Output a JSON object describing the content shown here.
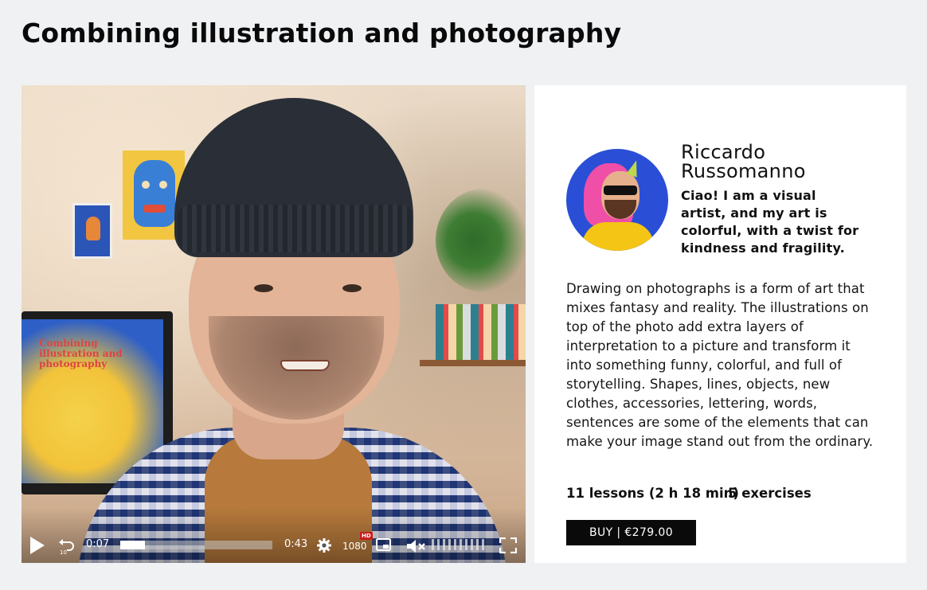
{
  "page": {
    "title": "Combining illustration and photography"
  },
  "video": {
    "current_time": "0:07",
    "duration": "0:43",
    "progress_fraction": 0.16,
    "quality": "1080",
    "hd_badge": "HD",
    "rewind_label": "10",
    "screen_text": "Combining illustration and photography",
    "icons": [
      "play-icon",
      "rewind-10-icon",
      "settings-gear-icon",
      "picture-in-picture-icon",
      "muted-speaker-icon",
      "fullscreen-icon"
    ]
  },
  "author": {
    "name": "Riccardo Russomanno",
    "bio": "Ciao! I am a visual artist, and my art is colorful, with a twist for kindness and fragility."
  },
  "course": {
    "description": "Drawing on photographs is a form of art that mixes fantasy and reality. The illustrations on top of the photo add extra layers of interpretation to a picture and transform it into something funny, colorful, and full of storytelling. Shapes, lines, objects, new clothes, accessories, lettering, words, sentences are some of the elements that can make your image stand out from the ordinary.",
    "lessons": "11 lessons (2 h 18 min)",
    "exercises": "5 exercises",
    "buy_label": "BUY | €279.00"
  },
  "colors": {
    "page_bg": "#f0f1f3",
    "card_bg": "#ffffff",
    "button_bg": "#0a0a0a",
    "hd_badge": "#c81e1e"
  }
}
